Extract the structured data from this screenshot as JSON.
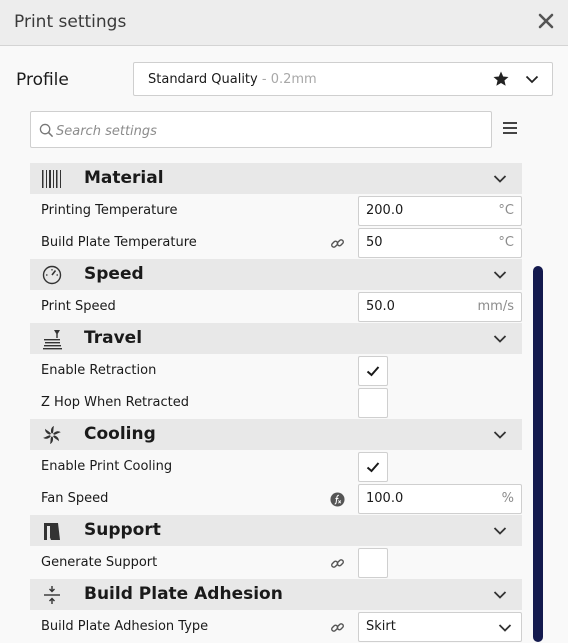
{
  "window": {
    "title": "Print settings"
  },
  "profile": {
    "label": "Profile",
    "selected_name": "Standard Quality",
    "selected_detail": " - 0.2mm"
  },
  "search": {
    "placeholder": "Search settings"
  },
  "categories": [
    {
      "name": "Material",
      "icon": "material-icon",
      "settings": [
        {
          "label": "Printing Temperature",
          "value": "200.0",
          "unit": "°C"
        },
        {
          "label": "Build Plate Temperature",
          "value": "50",
          "unit": "°C",
          "linked": true
        }
      ]
    },
    {
      "name": "Speed",
      "icon": "speed-gauge-icon",
      "settings": [
        {
          "label": "Print Speed",
          "value": "50.0",
          "unit": "mm/s"
        }
      ]
    },
    {
      "name": "Travel",
      "icon": "travel-icon",
      "settings": [
        {
          "label": "Enable Retraction",
          "checked": true
        },
        {
          "label": "Z Hop When Retracted",
          "checked": false
        }
      ]
    },
    {
      "name": "Cooling",
      "icon": "fan-icon",
      "settings": [
        {
          "label": "Enable Print Cooling",
          "checked": true
        },
        {
          "label": "Fan Speed",
          "value": "100.0",
          "unit": "%",
          "formula": true
        }
      ]
    },
    {
      "name": "Support",
      "icon": "support-icon",
      "settings": [
        {
          "label": "Generate Support",
          "checked": false,
          "linked": true
        }
      ]
    },
    {
      "name": "Build Plate Adhesion",
      "icon": "adhesion-icon",
      "settings": [
        {
          "label": "Build Plate Adhesion Type",
          "value": "Skirt",
          "linked": true,
          "dropdown": true
        }
      ]
    }
  ],
  "colors": {
    "category_background": "#e8e8e8",
    "scrollbar": "#141a4e",
    "background": "#f9f9f9"
  }
}
